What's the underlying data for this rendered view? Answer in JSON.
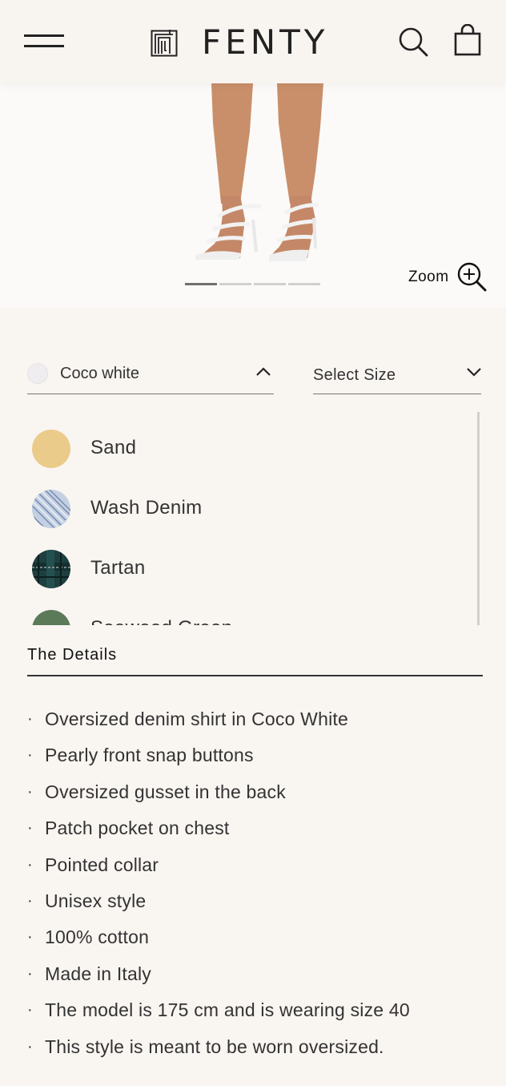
{
  "header": {
    "brand": "FENTY",
    "menu_icon": "hamburger-menu-icon",
    "search_icon": "search-icon",
    "bag_icon": "shopping-bag-icon"
  },
  "hero": {
    "zoom_label": "Zoom",
    "zoom_icon": "zoom-in-icon",
    "carousel": {
      "count": 4,
      "active_index": 1
    }
  },
  "color_select": {
    "selected": "Coco white",
    "expanded": true,
    "options": [
      {
        "label": "Sand",
        "color": "#ebcb89"
      },
      {
        "label": "Wash Denim",
        "color": "#a8b8d0"
      },
      {
        "label": "Tartan",
        "color": "#1e3f3f"
      },
      {
        "label": "Seaweed Green",
        "color": "#5a7a58"
      }
    ]
  },
  "size_select": {
    "placeholder": "Select Size"
  },
  "details": {
    "title": "The Details",
    "items": [
      "Oversized denim shirt in Coco White",
      "Pearly front snap buttons",
      "Oversized gusset in the back",
      "Patch pocket on chest",
      "Pointed collar",
      "Unisex style",
      "100% cotton",
      "Made in Italy",
      "The model is 175 cm and is wearing size 40",
      "This style is meant to be worn oversized."
    ]
  }
}
